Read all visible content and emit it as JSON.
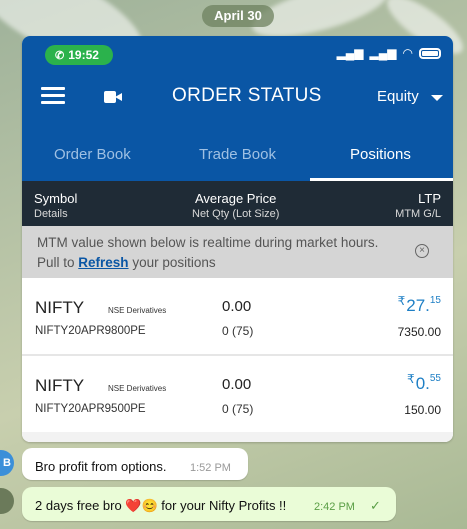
{
  "chat": {
    "date_label": "April 30",
    "messages": [
      {
        "text": "Bro profit from options.",
        "time": "1:52 PM",
        "avatar": "B"
      },
      {
        "text": "2 days free bro ❤️😊 for your Nifty Profits !!",
        "time": "2:42 PM",
        "status": "read-check"
      }
    ]
  },
  "status_bar": {
    "call_time": "19:52",
    "call_icon": "phone-icon",
    "system_icons": [
      "signal-icon",
      "signal-icon",
      "wifi-icon",
      "battery-icon"
    ]
  },
  "app_bar": {
    "title": "ORDER STATUS",
    "segment": "Equity",
    "menu_icon": "hamburger-icon",
    "video_icon": "video-camera-icon"
  },
  "tabs": [
    {
      "label": "Order Book",
      "active": false
    },
    {
      "label": "Trade Book",
      "active": false
    },
    {
      "label": "Positions",
      "active": true
    }
  ],
  "columns": {
    "symbol": "Symbol",
    "symbol_sub": "Details",
    "avg_price": "Average Price",
    "avg_price_sub": "Net Qty (Lot Size)",
    "ltp": "LTP",
    "ltp_sub": "MTM G/L"
  },
  "notice": {
    "line1": "MTM value shown below is realtime during market hours.",
    "line2_pre": "Pull to ",
    "line2_link": "Refresh",
    "line2_post": " your positions",
    "close_icon": "circle-x-icon"
  },
  "positions": [
    {
      "symbol": "NIFTY",
      "exchange": "NSE Derivatives",
      "contract": "NIFTY20APR9800PE",
      "avg_price": "0.00",
      "qty": "0 (75)",
      "ltp_currency": "₹",
      "ltp_int": "27.",
      "ltp_dec": "15",
      "mtm": "7350.00"
    },
    {
      "symbol": "NIFTY",
      "exchange": "NSE Derivatives",
      "contract": "NIFTY20APR9500PE",
      "avg_price": "0.00",
      "qty": "0 (75)",
      "ltp_currency": "₹",
      "ltp_int": "0.",
      "ltp_dec": "55",
      "mtm": "150.00"
    }
  ],
  "colors": {
    "app_blue": "#0a56a5",
    "header_dark": "#1f2b36",
    "ltp_blue": "#1e7fc5",
    "call_green": "#2bb24c",
    "outgoing_bubble": "#eafcd7"
  }
}
